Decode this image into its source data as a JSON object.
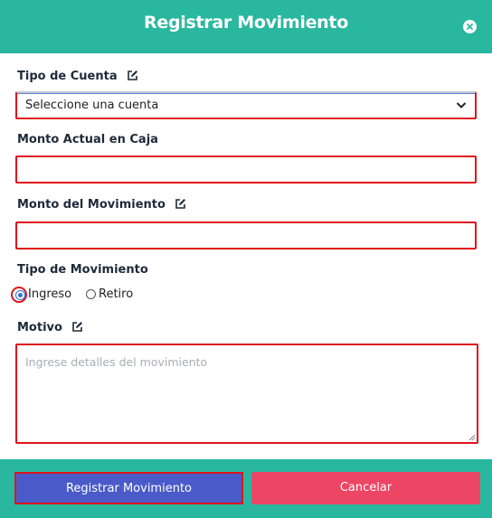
{
  "modal": {
    "title": "Registrar Movimiento"
  },
  "form": {
    "account_type": {
      "label": "Tipo de Cuenta",
      "selected": "Seleccione una cuenta"
    },
    "current_amount": {
      "label": "Monto Actual en Caja",
      "value": ""
    },
    "movement_amount": {
      "label": "Monto del Movimiento",
      "value": ""
    },
    "movement_type": {
      "label": "Tipo de Movimiento",
      "options": [
        "Ingreso",
        "Retiro"
      ],
      "selected": "Ingreso"
    },
    "reason": {
      "label": "Motivo",
      "placeholder": "Ingrese detalles del movimiento",
      "value": ""
    }
  },
  "footer": {
    "submit_label": "Registrar Movimiento",
    "cancel_label": "Cancelar"
  },
  "colors": {
    "header_bg": "#2ab7a0",
    "primary_button": "#4a5bc9",
    "cancel_button": "#ed4664",
    "highlight_border": "#e0141c"
  }
}
